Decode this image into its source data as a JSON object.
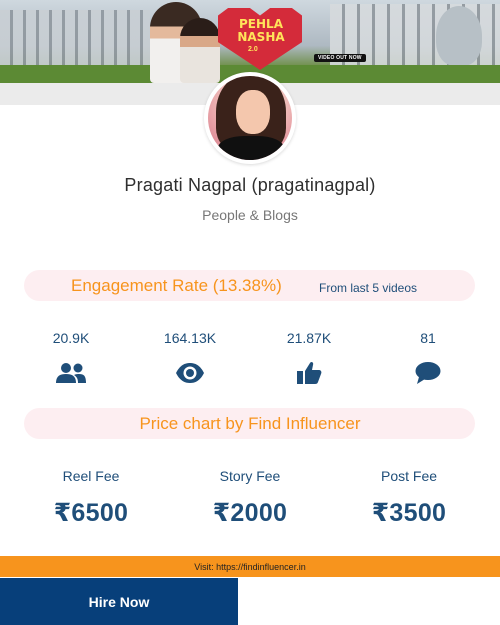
{
  "banner": {
    "logo_line1": "PEHLA",
    "logo_line2": "NASHA",
    "logo_sub": "2.0",
    "video_tag": "VIDEO OUT NOW"
  },
  "profile": {
    "name": "Pragati Nagpal (pragatinagpal)",
    "category": "People & Blogs"
  },
  "engagement": {
    "title": "Engagement Rate (13.38%)",
    "subtitle": "From last 5 videos"
  },
  "stats": [
    {
      "value": "20.9K",
      "icon": "followers-icon"
    },
    {
      "value": "164.13K",
      "icon": "eye-icon"
    },
    {
      "value": "21.87K",
      "icon": "thumbs-up-icon"
    },
    {
      "value": "81",
      "icon": "comment-icon"
    }
  ],
  "price_chart": {
    "title": "Price chart by Find Influencer",
    "fees": [
      {
        "label": "Reel Fee",
        "amount": "₹6500"
      },
      {
        "label": "Story Fee",
        "amount": "₹2000"
      },
      {
        "label": "Post Fee",
        "amount": "₹3500"
      }
    ]
  },
  "footer": {
    "visit_text": "Visit: https://findinfluencer.in",
    "hire_label": "Hire Now"
  },
  "colors": {
    "accent_orange": "#f7941d",
    "navy": "#1f4e79",
    "hire_bg": "#073f7a",
    "pill_bg": "#fdeef1"
  }
}
